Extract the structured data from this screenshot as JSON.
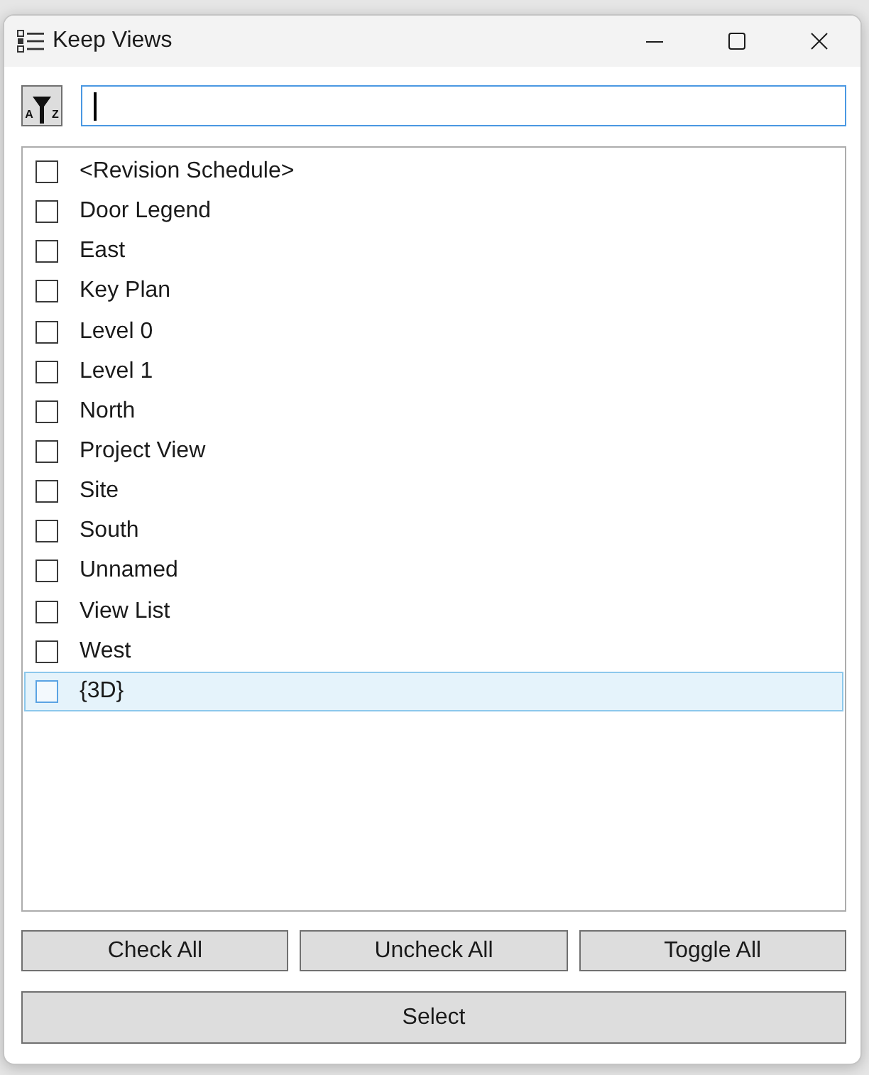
{
  "window": {
    "title": "Keep Views"
  },
  "sort_button": {
    "letters": [
      "A",
      "Z"
    ]
  },
  "search": {
    "focused": true
  },
  "views": [
    {
      "label": "<Revision Schedule>",
      "checked": false,
      "selected": false
    },
    {
      "label": "Door Legend",
      "checked": false,
      "selected": false
    },
    {
      "label": "East",
      "checked": false,
      "selected": false
    },
    {
      "label": "Key Plan",
      "checked": false,
      "selected": false
    },
    {
      "label": "Level 0",
      "checked": false,
      "selected": false
    },
    {
      "label": "Level 1",
      "checked": false,
      "selected": false
    },
    {
      "label": "North",
      "checked": false,
      "selected": false
    },
    {
      "label": "Project View",
      "checked": false,
      "selected": false
    },
    {
      "label": "Site",
      "checked": false,
      "selected": false
    },
    {
      "label": "South",
      "checked": false,
      "selected": false
    },
    {
      "label": "Unnamed",
      "checked": false,
      "selected": false
    },
    {
      "label": "View List",
      "checked": false,
      "selected": false
    },
    {
      "label": "West",
      "checked": false,
      "selected": false
    },
    {
      "label": "{3D}",
      "checked": false,
      "selected": true
    }
  ],
  "buttons": [
    {
      "label": "Check All"
    },
    {
      "label": "Uncheck All"
    },
    {
      "label": "Toggle All"
    }
  ],
  "select_button": {
    "label": "Select"
  }
}
